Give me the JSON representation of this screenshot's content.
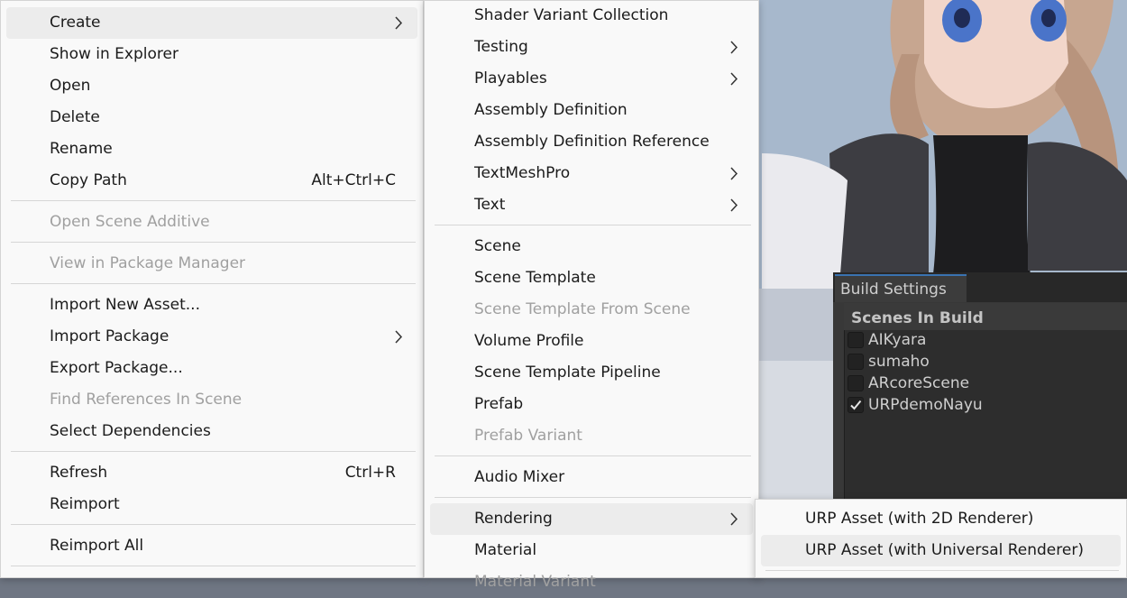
{
  "main_menu": {
    "items": [
      {
        "label": "Create",
        "submenu": true,
        "highlighted": true
      },
      {
        "label": "Show in Explorer"
      },
      {
        "label": "Open"
      },
      {
        "label": "Delete"
      },
      {
        "label": "Rename"
      },
      {
        "label": "Copy Path",
        "shortcut": "Alt+Ctrl+C"
      },
      {
        "label": "Open Scene Additive",
        "disabled": true
      },
      {
        "label": "View in Package Manager",
        "disabled": true
      },
      {
        "label": "Import New Asset..."
      },
      {
        "label": "Import Package",
        "submenu": true
      },
      {
        "label": "Export Package..."
      },
      {
        "label": "Find References In Scene",
        "disabled": true
      },
      {
        "label": "Select Dependencies"
      },
      {
        "label": "Refresh",
        "shortcut": "Ctrl+R"
      },
      {
        "label": "Reimport"
      },
      {
        "label": "Reimport All"
      }
    ]
  },
  "create_menu": {
    "items": [
      {
        "label": "Shader Variant Collection"
      },
      {
        "label": "Testing",
        "submenu": true
      },
      {
        "label": "Playables",
        "submenu": true
      },
      {
        "label": "Assembly Definition"
      },
      {
        "label": "Assembly Definition Reference"
      },
      {
        "label": "TextMeshPro",
        "submenu": true
      },
      {
        "label": "Text",
        "submenu": true
      },
      {
        "label": "Scene"
      },
      {
        "label": "Scene Template"
      },
      {
        "label": "Scene Template From Scene",
        "disabled": true
      },
      {
        "label": "Volume Profile"
      },
      {
        "label": "Scene Template Pipeline"
      },
      {
        "label": "Prefab"
      },
      {
        "label": "Prefab Variant",
        "disabled": true
      },
      {
        "label": "Audio Mixer"
      },
      {
        "label": "Rendering",
        "submenu": true,
        "highlighted": true
      },
      {
        "label": "Material"
      },
      {
        "label": "Material Variant",
        "disabled": true
      }
    ]
  },
  "rendering_menu": {
    "items": [
      {
        "label": "URP Asset (with 2D Renderer)"
      },
      {
        "label": "URP Asset (with Universal Renderer)",
        "highlighted": true
      }
    ]
  },
  "build_settings": {
    "tab_title": "Build Settings",
    "section_title": "Scenes In Build",
    "scenes": [
      {
        "name": "AIKyara",
        "checked": false
      },
      {
        "name": "sumaho",
        "checked": false
      },
      {
        "name": "ARcoreScene",
        "checked": false
      },
      {
        "name": "URPdemoNayu",
        "checked": true
      }
    ]
  },
  "colors": {
    "menu_bg": "#f9f9f9",
    "menu_hover": "#ececec",
    "menu_text": "#1b1b1b",
    "menu_disabled": "#a0a0a0",
    "editor_dark": "#383838"
  }
}
